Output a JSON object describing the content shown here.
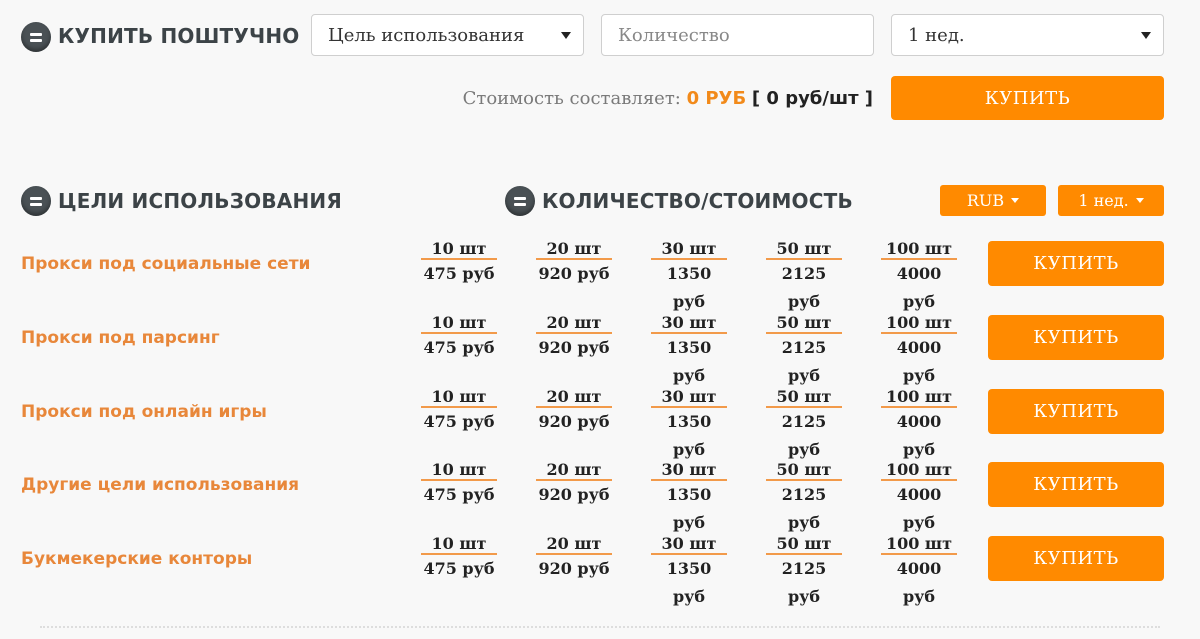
{
  "piece": {
    "title": "КУПИТЬ ПОШТУЧНО",
    "purpose_select": "Цель использования",
    "quantity_placeholder": "Количество",
    "period_select": "1 нед.",
    "cost_label": "Стоимость составляет:",
    "cost_value": "0 РУБ",
    "cost_unit": "[ 0 руб/шт ]",
    "buy_label": "КУПИТЬ"
  },
  "packages": {
    "purposes_title": "ЦЕЛИ ИСПОЛЬЗОВАНИЯ",
    "qty_cost_title": "КОЛИЧЕСТВО/СТОИМОСТЬ",
    "currency": "RUB",
    "period": "1 нед.",
    "buy_label": "КУПИТЬ",
    "rows": [
      {
        "label": "Прокси под социальные сети",
        "options": [
          {
            "qty": "10 шт",
            "price": "475 руб"
          },
          {
            "qty": "20 шт",
            "price": "920 руб"
          },
          {
            "qty": "30 шт",
            "price": "1350 руб"
          },
          {
            "qty": "50 шт",
            "price": "2125 руб"
          },
          {
            "qty": "100 шт",
            "price": "4000 руб"
          }
        ]
      },
      {
        "label": "Прокси под парсинг",
        "options": [
          {
            "qty": "10 шт",
            "price": "475 руб"
          },
          {
            "qty": "20 шт",
            "price": "920 руб"
          },
          {
            "qty": "30 шт",
            "price": "1350 руб"
          },
          {
            "qty": "50 шт",
            "price": "2125 руб"
          },
          {
            "qty": "100 шт",
            "price": "4000 руб"
          }
        ]
      },
      {
        "label": "Прокси под онлайн игры",
        "options": [
          {
            "qty": "10 шт",
            "price": "475 руб"
          },
          {
            "qty": "20 шт",
            "price": "920 руб"
          },
          {
            "qty": "30 шт",
            "price": "1350 руб"
          },
          {
            "qty": "50 шт",
            "price": "2125 руб"
          },
          {
            "qty": "100 шт",
            "price": "4000 руб"
          }
        ]
      },
      {
        "label": "Другие цели использования",
        "options": [
          {
            "qty": "10 шт",
            "price": "475 руб"
          },
          {
            "qty": "20 шт",
            "price": "920 руб"
          },
          {
            "qty": "30 шт",
            "price": "1350 руб"
          },
          {
            "qty": "50 шт",
            "price": "2125 руб"
          },
          {
            "qty": "100 шт",
            "price": "4000 руб"
          }
        ]
      },
      {
        "label": "Букмекерские конторы",
        "options": [
          {
            "qty": "10 шт",
            "price": "475 руб"
          },
          {
            "qty": "20 шт",
            "price": "920 руб"
          },
          {
            "qty": "30 шт",
            "price": "1350 руб"
          },
          {
            "qty": "50 шт",
            "price": "2125 руб"
          },
          {
            "qty": "100 шт",
            "price": "4000 руб"
          }
        ]
      }
    ]
  },
  "colors": {
    "accent": "#ff8a00",
    "label_orange": "#e8873a",
    "icon_dark": "#4a5155"
  }
}
